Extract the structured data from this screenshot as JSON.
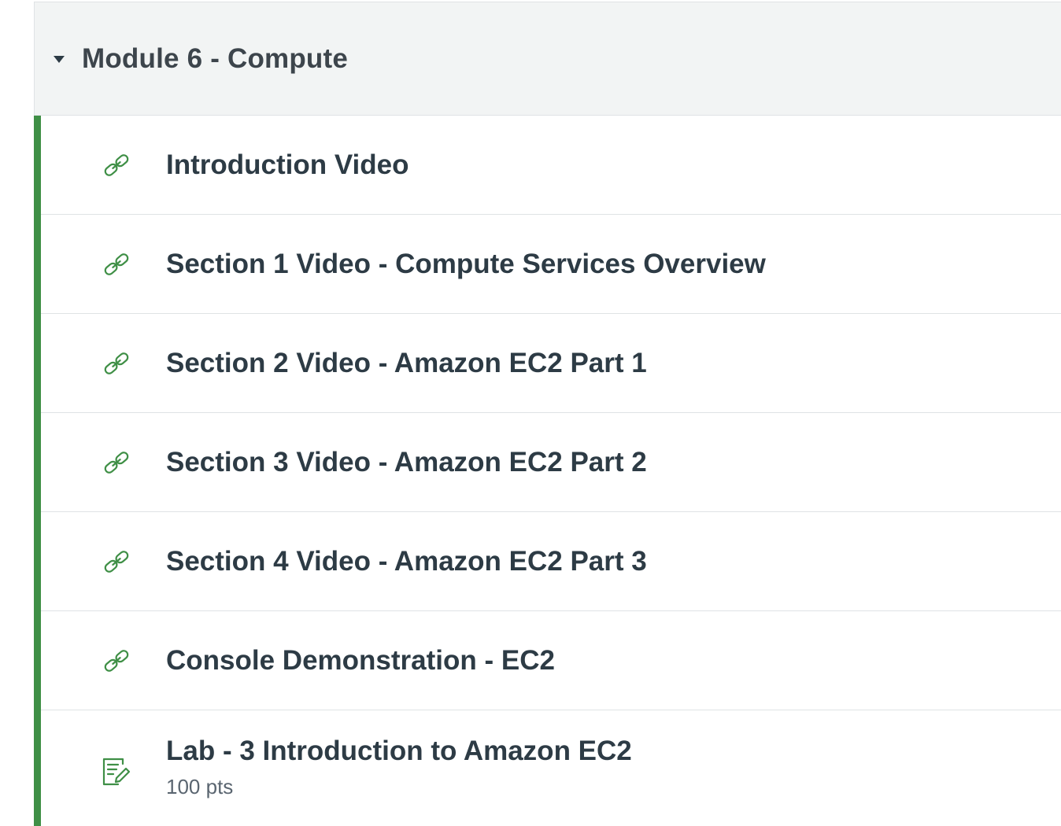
{
  "module": {
    "title": "Module 6 - Compute",
    "collapse_icon": "caret-down-icon",
    "accent_color": "#3f8f46"
  },
  "items": [
    {
      "title": "Introduction Video",
      "icon": "link-icon",
      "type": "external-link"
    },
    {
      "title": "Section 1 Video - Compute Services Overview",
      "icon": "link-icon",
      "type": "external-link"
    },
    {
      "title": "Section 2 Video - Amazon EC2 Part 1",
      "icon": "link-icon",
      "type": "external-link"
    },
    {
      "title": "Section 3 Video - Amazon EC2 Part 2",
      "icon": "link-icon",
      "type": "external-link"
    },
    {
      "title": "Section 4 Video - Amazon EC2 Part 3",
      "icon": "link-icon",
      "type": "external-link"
    },
    {
      "title": "Console Demonstration - EC2",
      "icon": "link-icon",
      "type": "external-link"
    },
    {
      "title": "Lab - 3 Introduction to Amazon EC2",
      "icon": "assignment-icon",
      "type": "assignment",
      "points": "100 pts"
    }
  ]
}
